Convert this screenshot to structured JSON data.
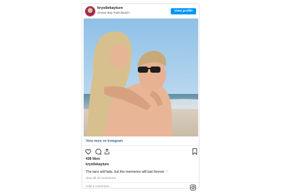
{
  "post": {
    "username": "krystlekayture",
    "location": "Ocean Bay Park Beach",
    "view_profile_label": "View profile",
    "view_more_label": "View more on Instagram",
    "likes": "438 likes",
    "caption_user": "krystlekayture",
    "caption_text": "The tans will fade, but the memories will last forever ♡",
    "comments_link": "view all 20 comments",
    "add_comment_placeholder": "Add a comment..."
  },
  "icons": {
    "like": "heart-icon",
    "comment": "comment-icon",
    "share": "share-icon",
    "save": "bookmark-icon",
    "instagram": "instagram-icon"
  },
  "colors": {
    "accent": "#0095f6",
    "link": "#00376b",
    "muted": "#8e8e8e",
    "border": "#e6e6e6"
  }
}
